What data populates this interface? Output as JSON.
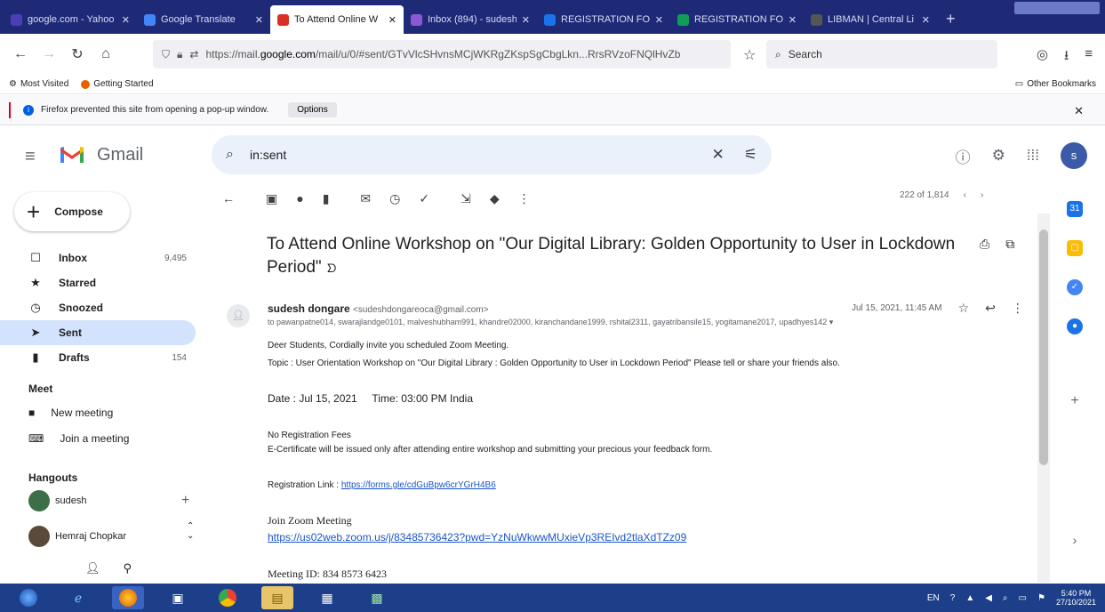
{
  "browser": {
    "tabs": [
      {
        "label": "google.com - Yahoo",
        "color": "#4a3fb5",
        "active": false
      },
      {
        "label": "Google Translate",
        "color": "#4285f4",
        "active": false
      },
      {
        "label": "To Attend Online W",
        "color": "#d93025",
        "active": true
      },
      {
        "label": "Inbox (894) - sudesh",
        "color": "#8d58d6",
        "active": false
      },
      {
        "label": "REGISTRATION FOR",
        "color": "#1a73e8",
        "active": false
      },
      {
        "label": "REGISTRATION FOR",
        "color": "#0f9d58",
        "active": false
      },
      {
        "label": "LIBMAN | Central Li",
        "color": "#555555",
        "active": false
      }
    ],
    "url_prefix": "https://mail.",
    "url_host": "google.com",
    "url_path": "/mail/u/0/#sent/GTvVlcSHvnsMCjWKRgZKspSgCbgLkn...RrsRVzoFNQlHvZb",
    "search_placeholder": "Search",
    "bookmarks": [
      "Most Visited",
      "Getting Started"
    ],
    "other_bookmarks": "Other Bookmarks",
    "notification": "Firefox prevented this site from opening a pop-up window.",
    "notification_button": "Options"
  },
  "gmail": {
    "brand": "Gmail",
    "search_value": "in:sent",
    "avatar_letter": "s",
    "compose": "Compose",
    "nav": [
      {
        "label": "Inbox",
        "count": "9,495",
        "icon": "inbox-icon",
        "glyph": "☐"
      },
      {
        "label": "Starred",
        "count": "",
        "icon": "star-icon",
        "glyph": "★"
      },
      {
        "label": "Snoozed",
        "count": "",
        "icon": "clock-icon",
        "glyph": "◷"
      },
      {
        "label": "Sent",
        "count": "",
        "icon": "send-icon",
        "glyph": "➤"
      },
      {
        "label": "Drafts",
        "count": "154",
        "icon": "draft-icon",
        "glyph": "▮"
      }
    ],
    "meet_title": "Meet",
    "meet_items": [
      "New meeting",
      "Join a meeting"
    ],
    "hangouts_title": "Hangouts",
    "hangouts_users": [
      "sudesh",
      "Hemraj Chopkar"
    ],
    "pager": "222 of 1,814"
  },
  "message": {
    "subject": "To Attend Online Workshop on \"Our Digital Library: Golden Opportunity to User in Lockdown Period\"",
    "sender_name": "sudesh dongare",
    "sender_email": "<sudeshdongareoca@gmail.com>",
    "date": "Jul 15, 2021, 11:45 AM",
    "recipients": "to pawanpatne014, swarajlandge0101, malveshubham991, khandre02000, kiranchandane1999, rshital2311, gayatribansile15, yogitamane2017, upadhyes142",
    "line1": "Deer Students, Cordially invite you scheduled Zoom Meeting.",
    "line2": "Topic : User Orientation Workshop on \"Our Digital Library : Golden Opportunity to User in Lockdown Period\" Please tell or share your friends also.",
    "date_line": "Date : Jul 15, 2021",
    "time_line": "Time: 03:00 PM India",
    "fees": "No Registration Fees",
    "certificate": "E-Certificate will be issued only after attending entire workshop and submitting your precious your feedback form.",
    "reg_label": "Registration Link : ",
    "reg_link": "https://forms.gle/cdGuBpw6crYGrH4B6",
    "zoom_title": "Join Zoom Meeting",
    "zoom_link": "https://us02web.zoom.us/j/83485736423?pwd=YzNuWkwwMUxieVp3REIvd2tlaXdTZz09",
    "meeting_id": "Meeting ID: 834 8573 6423"
  },
  "taskbar": {
    "time": "5:40 PM",
    "date": "27/10/2021",
    "lang": "EN"
  },
  "colors": {
    "tabstrip": "#1f2a77",
    "accent_blue": "#1a55c8",
    "gmail_red": "#d93025",
    "taskbar": "#1d3f8a"
  }
}
